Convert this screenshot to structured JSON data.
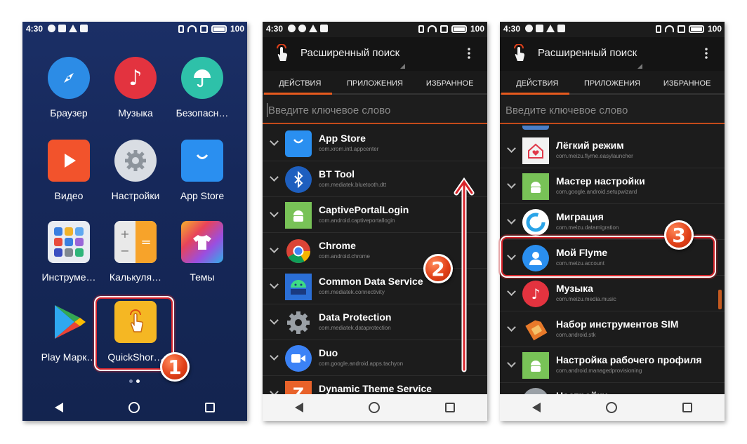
{
  "colors": {
    "accent": "#e75a1e",
    "highlight": "#d8242b",
    "home_bg": "#1b2f66",
    "app_bg": "#1c1c1c"
  },
  "status_bar": {
    "time": "4:30",
    "battery": "100"
  },
  "screen1": {
    "apps": [
      {
        "label": "Браузер",
        "icon": "compass-icon",
        "color": "#2c8ce6"
      },
      {
        "label": "Музыка",
        "icon": "music-note-icon",
        "color": "#e3333f"
      },
      {
        "label": "Безопасн…",
        "icon": "umbrella-icon",
        "color": "#2ec1a9"
      },
      {
        "label": "Видео",
        "icon": "play-icon",
        "color": "#f2532c"
      },
      {
        "label": "Настройки",
        "icon": "gear-icon",
        "color": "#d9dde3"
      },
      {
        "label": "App Store",
        "icon": "shopping-bag-icon",
        "color": "#2a8ff0"
      },
      {
        "label": "Инструме…",
        "icon": "tools-folder-icon",
        "color": "#e9ecf2"
      },
      {
        "label": "Калькуля…",
        "icon": "calculator-icon",
        "color": "#f4f4f4"
      },
      {
        "label": "Темы",
        "icon": "tshirt-icon",
        "color": "#c044d8"
      },
      {
        "label": "Play Марк…",
        "icon": "play-store-icon",
        "color": "#34a853"
      },
      {
        "label": "QuickShor…",
        "icon": "tap-hand-icon",
        "color": "#f5b723"
      }
    ],
    "step": "1"
  },
  "app_screen": {
    "title": "Расширенный поиск",
    "tabs": [
      "ДЕЙСТВИЯ",
      "ПРИЛОЖЕНИЯ",
      "ИЗБРАННОЕ"
    ],
    "search_placeholder": "Введите ключевое слово"
  },
  "screen2": {
    "step": "2",
    "rows": [
      {
        "name": "App Store",
        "package": "com.xrom.intl.appcenter",
        "icon": "shopping-bag-icon",
        "color": "#2a8ff0"
      },
      {
        "name": "BT Tool",
        "package": "com.mediatek.bluetooth.dtt",
        "icon": "bluetooth-icon",
        "color": "#1e5fbf"
      },
      {
        "name": "CaptivePortalLogin",
        "package": "com.android.captiveportallogin",
        "icon": "android-icon",
        "color": "#78c257"
      },
      {
        "name": "Chrome",
        "package": "com.android.chrome",
        "icon": "chrome-icon",
        "color": "#db4437"
      },
      {
        "name": "Common Data Service",
        "package": "com.mediatek.connectivity",
        "icon": "android-bot-icon",
        "color": "#2b6fd6"
      },
      {
        "name": "Data Protection",
        "package": "com.mediatek.dataprotection",
        "icon": "gear-icon",
        "color": "#9aa0a6"
      },
      {
        "name": "Duo",
        "package": "com.google.android.apps.tachyon",
        "icon": "video-camera-icon",
        "color": "#3b82f6"
      },
      {
        "name": "Dynamic Theme Service",
        "package": "",
        "icon": "theme-z-icon",
        "color": "#e8622a"
      }
    ]
  },
  "screen3": {
    "step": "3",
    "rows": [
      {
        "name": "Лёгкий режим",
        "package": "com.meizu.flyme.easylauncher",
        "icon": "home-heart-icon",
        "color": "#f2f2f2"
      },
      {
        "name": "Мастер настройки",
        "package": "com.google.android.setupwizard",
        "icon": "android-icon",
        "color": "#78c257"
      },
      {
        "name": "Миграция",
        "package": "com.meizu.datamigration",
        "icon": "migration-icon",
        "color": "#2aa4e8"
      },
      {
        "name": "Мой Flyme",
        "package": "com.meizu.account",
        "icon": "user-icon",
        "color": "#2a8ff0"
      },
      {
        "name": "Музыка",
        "package": "com.meizu.media.music",
        "icon": "music-note-icon",
        "color": "#e3333f"
      },
      {
        "name": "Набор инструментов SIM",
        "package": "com.android.stk",
        "icon": "sim-card-icon",
        "color": "#e87a2a"
      },
      {
        "name": "Настройка рабочего профиля",
        "package": "com.android.managedprovisioning",
        "icon": "android-icon",
        "color": "#78c257"
      },
      {
        "name": "Настройки",
        "package": "",
        "icon": "gear-icon",
        "color": "#9aa0a6"
      }
    ]
  }
}
